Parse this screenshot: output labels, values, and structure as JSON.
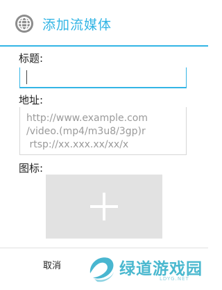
{
  "dialog": {
    "title": "添加流媒体",
    "app_icon": "globe-icon",
    "accent_color": "#33b5e5"
  },
  "form": {
    "title_label": "标题:",
    "title_value": "",
    "address_label": "地址:",
    "address_placeholder": "http://www.example.com\n/video.(mp4/m3u8/3gp)r\n rtsp://xx.xxx.xx/xx/x",
    "icon_label": "图标:",
    "icon_picker_symbol": "plus-icon"
  },
  "footer": {
    "cancel_label": "取消"
  },
  "watermark": {
    "text": "绿道游戏园",
    "subtext": "LDYG.NET"
  }
}
